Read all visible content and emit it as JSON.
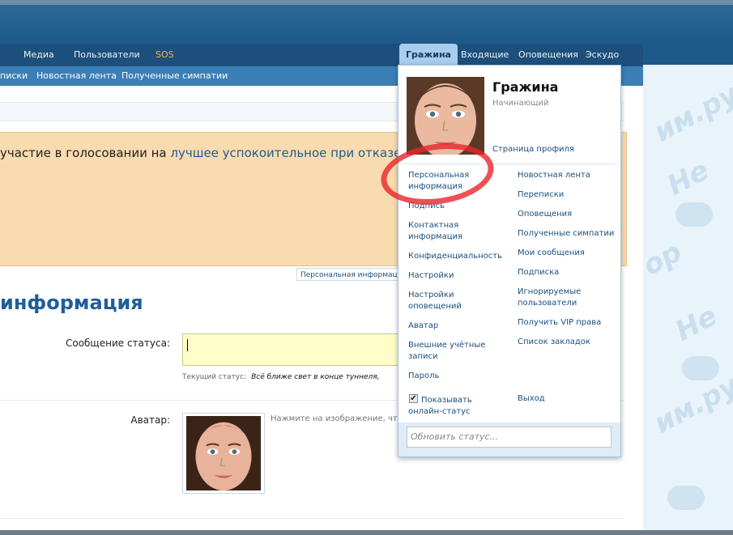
{
  "nav": {
    "tabs": [
      "Медиа",
      "Пользователи",
      "SOS"
    ],
    "user_tab": "Гражина",
    "right_tabs": [
      "Входящие",
      "Оповещения",
      "Эскудо"
    ]
  },
  "subnav": {
    "items": [
      "писки",
      "Новостная лента",
      "Полученные симпатии"
    ]
  },
  "notice": {
    "prefix": "участие в голосовании на ",
    "link": "лучшее успокоительное при отказе от к"
  },
  "breadcrumb_tag": "Персональная информация",
  "page_heading": "информация",
  "form": {
    "status_label": "Сообщение статуса:",
    "current_status_label": "Текущий статус:",
    "current_status_value": "Всё ближе свет в конце туннеля,",
    "avatar_label": "Аватар:",
    "avatar_hint": "Нажмите на изображение, чтоб"
  },
  "dropdown": {
    "name": "Гражина",
    "rank": "Начинающий",
    "profile_link": "Страница профиля",
    "left_links": [
      "Персональная информация",
      "Подпись",
      "Контактная информация",
      "Конфиденциальность",
      "Настройки",
      "Настройки оповещений",
      "Аватар",
      "Внешние учётные записи",
      "Пароль"
    ],
    "right_links": [
      "Новостная лента",
      "Переписки",
      "Оповещения",
      "Полученные симпатии",
      "Мои сообщения",
      "Подписка",
      "Игнорируемые пользователи",
      "Получить VIP права",
      "Список закладок"
    ],
    "online_status_label": "Показывать онлайн-статус",
    "online_checked": true,
    "logout": "Выход",
    "status_placeholder": "Обновить статус..."
  },
  "watermark": [
    "Не",
    "им.ру",
    "Не",
    "ор"
  ]
}
